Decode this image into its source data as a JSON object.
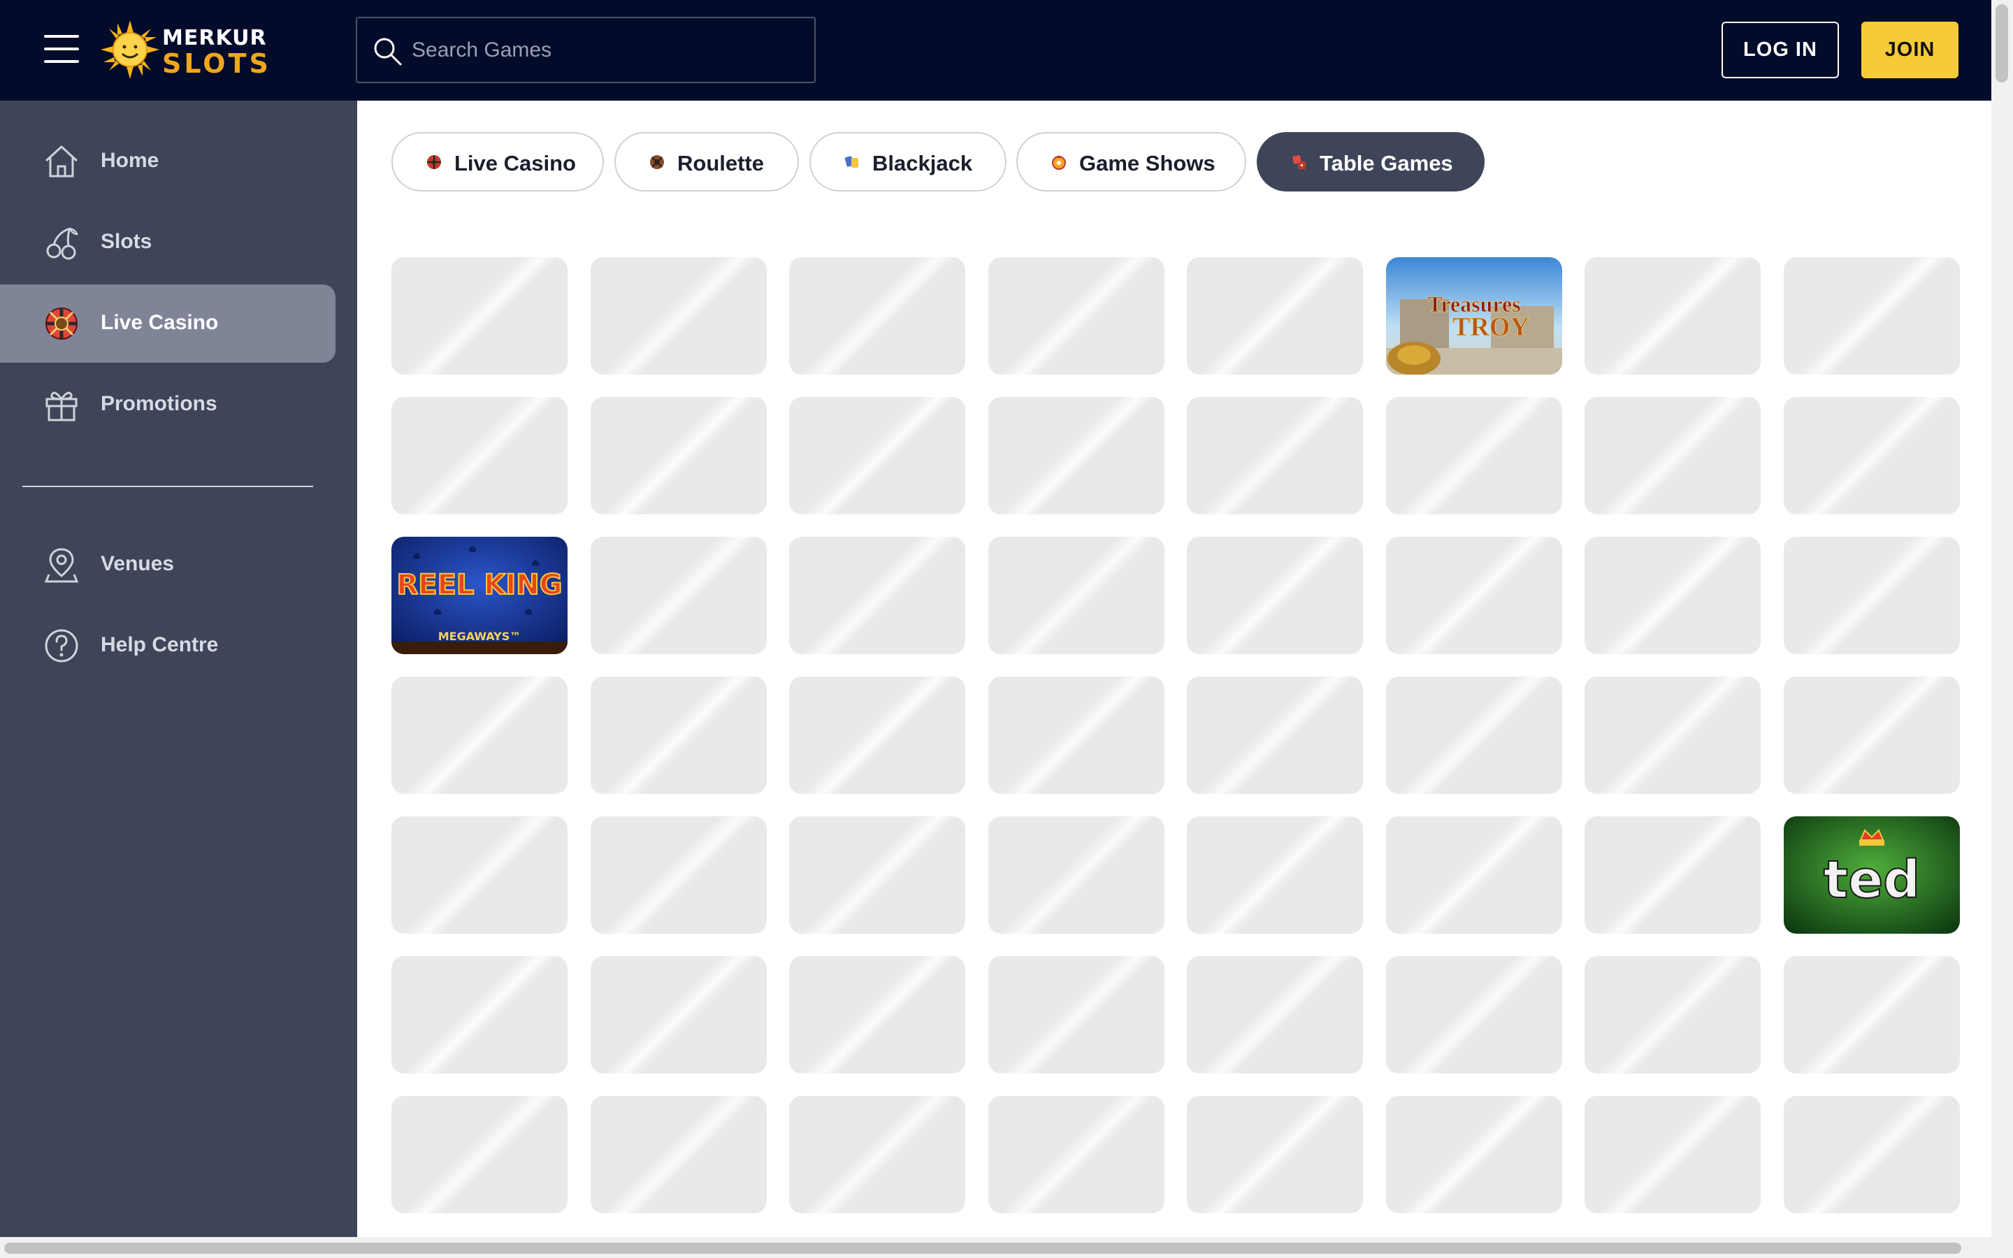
{
  "header": {
    "logo": {
      "line1": "MERKUR",
      "line2": "SLOTS"
    },
    "search": {
      "placeholder": "Search Games",
      "value": ""
    },
    "login_label": "LOG IN",
    "join_label": "JOIN",
    "colors": {
      "background": "#020b2a",
      "join": "#f6cb3a"
    }
  },
  "sidebar": {
    "items": [
      {
        "label": "Home",
        "icon": "home-icon"
      },
      {
        "label": "Slots",
        "icon": "cherries-icon"
      },
      {
        "label": "Live Casino",
        "icon": "roulette-wheel-icon",
        "active": true
      },
      {
        "label": "Promotions",
        "icon": "gift-icon"
      }
    ],
    "secondary": [
      {
        "label": "Venues",
        "icon": "location-pin-icon"
      },
      {
        "label": "Help Centre",
        "icon": "help-circle-icon"
      }
    ],
    "colors": {
      "background": "#3e4559",
      "active": "#7f8496"
    }
  },
  "categories": [
    {
      "label": "Live Casino",
      "icon": "roulette-icon"
    },
    {
      "label": "Roulette",
      "icon": "roulette-icon"
    },
    {
      "label": "Blackjack",
      "icon": "cards-icon"
    },
    {
      "label": "Game Shows",
      "icon": "wheel-icon"
    },
    {
      "label": "Table Games",
      "icon": "dice-icon",
      "active": true
    }
  ],
  "games": {
    "rows": 7,
    "columns": 8,
    "loaded": [
      {
        "row": 0,
        "col": 5,
        "title": "Treasures",
        "subtitle": "TROY"
      },
      {
        "row": 2,
        "col": 0,
        "title": "REEL KING",
        "subtitle": "MEGAWAYS™"
      },
      {
        "row": 4,
        "col": 7,
        "title": "ted",
        "subtitle": ""
      }
    ]
  }
}
